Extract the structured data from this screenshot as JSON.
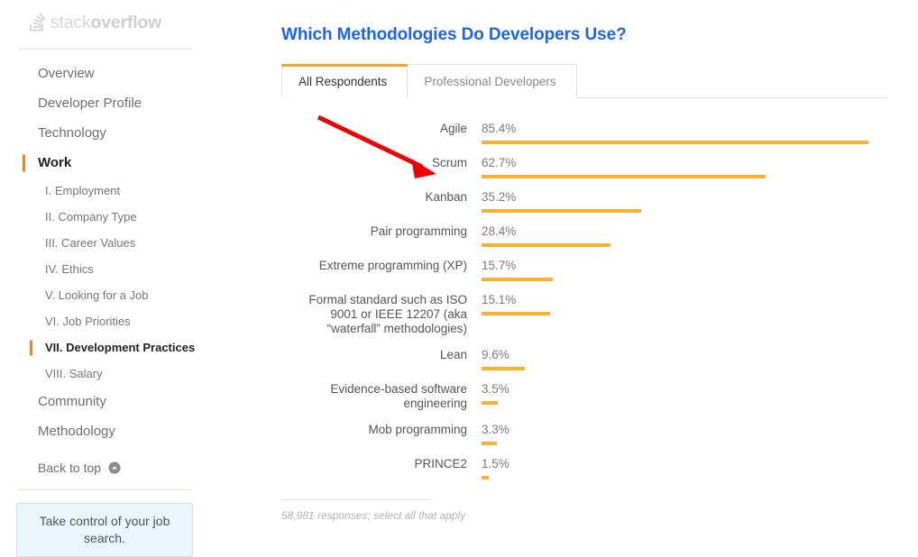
{
  "sidebar": {
    "logo": {
      "icon": "stack-overflow-logo-icon",
      "light_text": "stack",
      "bold_text": "overflow"
    },
    "items": [
      {
        "label": "Overview",
        "level": "top",
        "active": false
      },
      {
        "label": "Developer Profile",
        "level": "top",
        "active": false
      },
      {
        "label": "Technology",
        "level": "top",
        "active": false
      },
      {
        "label": "Work",
        "level": "top",
        "active": true
      },
      {
        "label": "I. Employment",
        "level": "sub",
        "active": false
      },
      {
        "label": "II. Company Type",
        "level": "sub",
        "active": false
      },
      {
        "label": "III. Career Values",
        "level": "sub",
        "active": false
      },
      {
        "label": "IV. Ethics",
        "level": "sub",
        "active": false
      },
      {
        "label": "V. Looking for a Job",
        "level": "sub",
        "active": false
      },
      {
        "label": "VI. Job Priorities",
        "level": "sub",
        "active": false
      },
      {
        "label": "VII. Development Practices",
        "level": "sub",
        "active": true
      },
      {
        "label": "VIII. Salary",
        "level": "sub",
        "active": false
      },
      {
        "label": "Community",
        "level": "top",
        "active": false
      },
      {
        "label": "Methodology",
        "level": "top",
        "active": false
      }
    ],
    "back_to_top": {
      "label": "Back to top",
      "icon": "chevron-up-circle-icon"
    },
    "promo": {
      "text": "Take control of your job search."
    }
  },
  "main": {
    "tabs": [
      {
        "label": "All Respondents",
        "active": true
      },
      {
        "label": "Professional Developers",
        "active": false
      }
    ]
  },
  "annotation": {
    "type": "red-arrow",
    "color": "#ee0000",
    "points_at": "Scrum"
  },
  "colors": {
    "title_blue": "#1c64e8",
    "bar_amber": "#f9b233",
    "accent_orange": "#f48024",
    "tab_active_top": "#f5a623",
    "promo_bg": "#eaf5fd",
    "promo_border": "#c9e3f5"
  },
  "chart_data": {
    "type": "bar",
    "orientation": "horizontal",
    "title": "Which Methodologies Do Developers Use?",
    "xlabel": "",
    "ylabel": "",
    "xlim": [
      0,
      100
    ],
    "grid": false,
    "legend": "none",
    "note": "58,981 responses; select all that apply",
    "categories": [
      "Agile",
      "Scrum",
      "Kanban",
      "Pair programming",
      "Extreme programming (XP)",
      "Formal standard such as ISO 9001 or IEEE 12207 (aka “waterfall” methodologies)",
      "Lean",
      "Evidence-based software engineering",
      "Mob programming",
      "PRINCE2"
    ],
    "values": [
      85.4,
      62.7,
      35.2,
      28.4,
      15.7,
      15.1,
      9.6,
      3.5,
      3.3,
      1.5
    ],
    "value_labels": [
      "85.4%",
      "62.7%",
      "35.2%",
      "28.4%",
      "15.7%",
      "15.1%",
      "9.6%",
      "3.5%",
      "3.3%",
      "1.5%"
    ]
  }
}
